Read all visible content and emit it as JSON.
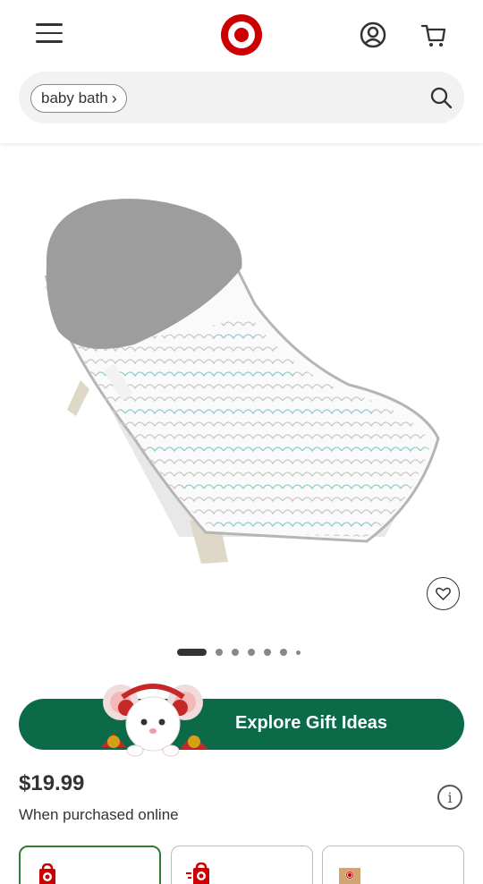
{
  "header": {
    "menu_icon": "hamburger-menu-icon",
    "logo_icon": "target-bullseye-logo",
    "account_icon": "account-icon",
    "cart_icon": "cart-icon",
    "brand_color": "#cc0000"
  },
  "search": {
    "chip_label": "baby bath",
    "chip_icon": "chevron-right-icon",
    "search_icon": "search-icon"
  },
  "product": {
    "image_icon": "baby-bath-seat-image",
    "favorite_icon": "heart-icon",
    "carousel": {
      "total_dots": 7,
      "active_index": 0
    }
  },
  "promo": {
    "label": "Explore Gift Ideas",
    "color": "#0b6a47",
    "mascot_icon": "mouse-mascot-illustration"
  },
  "pricing": {
    "price": "$19.99",
    "note": "When purchased online",
    "info_icon": "info-icon"
  },
  "fulfillment": {
    "cards": [
      {
        "icon": "store-pickup-icon",
        "selected": true
      },
      {
        "icon": "store-delivery-icon",
        "selected": false
      },
      {
        "icon": "shipping-box-icon",
        "selected": false
      }
    ],
    "selected_color": "#2e7d32"
  }
}
